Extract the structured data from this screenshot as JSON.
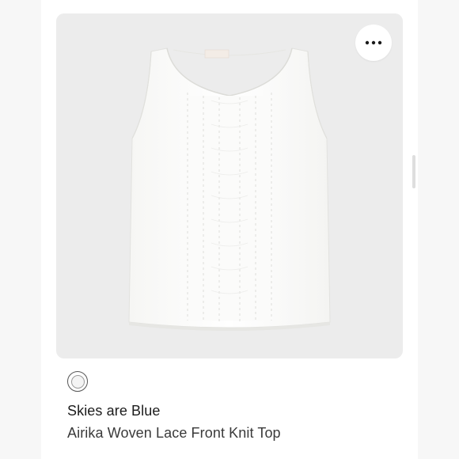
{
  "product": {
    "brand": "Skies are Blue",
    "title": "Airika Woven Lace Front Knit Top",
    "image_label": "",
    "swatch_color": "#f4f4f4"
  },
  "actions": {
    "more_icon": "more-horizontal-icon"
  },
  "colors": {
    "card_background": "#ececec",
    "page_background": "#ffffff",
    "brand_text": "#1c1c1c",
    "title_text": "#3a3a3a"
  }
}
